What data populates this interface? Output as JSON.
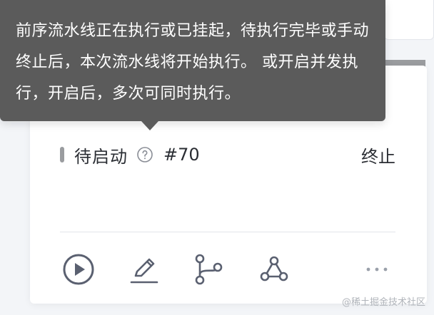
{
  "tooltip": {
    "text": "前序流水线正在执行或已挂起，待执行完毕或手动终止后，本次流水线将开始执行。 或开启并发执行，开启后，多次可同时执行。"
  },
  "card": {
    "status": "待启动",
    "run_number": "#70",
    "terminate_label": "终止"
  },
  "icons": {
    "help": "help-circle-icon",
    "run": "play-circle-icon",
    "edit": "pencil-icon",
    "branch": "git-branch-icon",
    "webhook": "webhook-icon",
    "more": "more-horizontal-icon"
  },
  "colors": {
    "tooltip_bg": "#5b5b5b",
    "status_bar": "#9a9c9f",
    "icon": "#5a6070",
    "text": "#2a2d33"
  },
  "watermark": "@稀土掘金技术社区"
}
